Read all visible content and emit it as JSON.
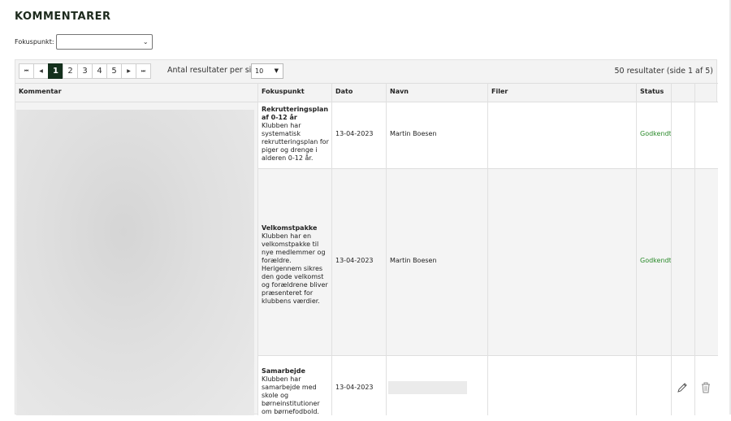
{
  "page": {
    "title": "KOMMENTARER"
  },
  "filter": {
    "label": "Fokuspunkt:",
    "value": ""
  },
  "pagination": {
    "first": "⏮",
    "prev": "◀",
    "next": "▶",
    "last": "⏭",
    "pages": [
      "1",
      "2",
      "3",
      "4",
      "5"
    ],
    "active_page": "1",
    "per_page_label": "Antal resultater per side",
    "per_page_value": "10",
    "results_text": "50 resultater (side 1 af 5)"
  },
  "table": {
    "columns": [
      "Kommentar",
      "Fokuspunkt",
      "Dato",
      "Navn",
      "Filer",
      "Status"
    ],
    "rows": [
      {
        "fokus_title": "Rekrutteringsplan af 0-12 år",
        "fokus_text": "Klubben har systematisk rekrutteringsplan for piger og drenge i alderen 0-12 år.",
        "dato": "13-04-2023",
        "navn": "Martin Boesen",
        "status": "Godkendt"
      },
      {
        "fokus_title": "Velkomstpakke",
        "fokus_text": "Klubben har en velkomstpakke til nye medlemmer og forældre. Herigennem sikres den gode velkomst og forældrene bliver præsenteret for klubbens værdier.",
        "dato": "13-04-2023",
        "navn": "Martin Boesen",
        "status": "Godkendt"
      },
      {
        "fokus_title": "Samarbejde",
        "fokus_text": "Klubben har samarbejde med skole og børneinstitutioner om børnefodbold.",
        "dato": "13-04-2023",
        "navn": "",
        "status": ""
      }
    ]
  },
  "colors": {
    "accent": "#13301c",
    "status_ok": "#2a8a2a"
  },
  "icons": {
    "edit": "pencil-icon",
    "delete": "trash-icon"
  }
}
